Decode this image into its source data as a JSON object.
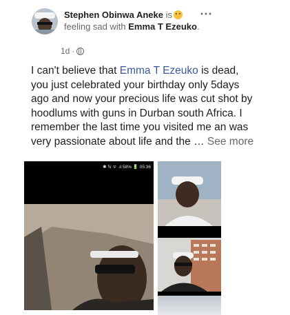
{
  "post": {
    "author": "Stephen Obinwa Aneke",
    "status_prefix": "is",
    "feeling_text": "feeling sad with",
    "tagged": "Emma T Ezeuko",
    "period": ".",
    "time": "1d",
    "time_sep": "·",
    "more_icon": "⋯",
    "body_before": "I can't believe that ",
    "mention": "Emma T Ezeuko",
    "body_after": "  is dead, you just celebrated your birthday only 5days ago and now your precious life was cut shot by hoodlums with guns in Durban south Africa. I remember the last time you visited me an was very passionate about life and the … ",
    "see_more": "See more"
  },
  "photos": {
    "status_bar": "✱ ℕ ᯤ .ıl 58% 🔋 05:36"
  },
  "icons": {
    "feeling": "sad-face-emoji",
    "privacy": "globe-icon",
    "options": "more-options-icon"
  },
  "colors": {
    "link": "#385898",
    "muted": "#65676b",
    "text": "#1c1e21"
  }
}
